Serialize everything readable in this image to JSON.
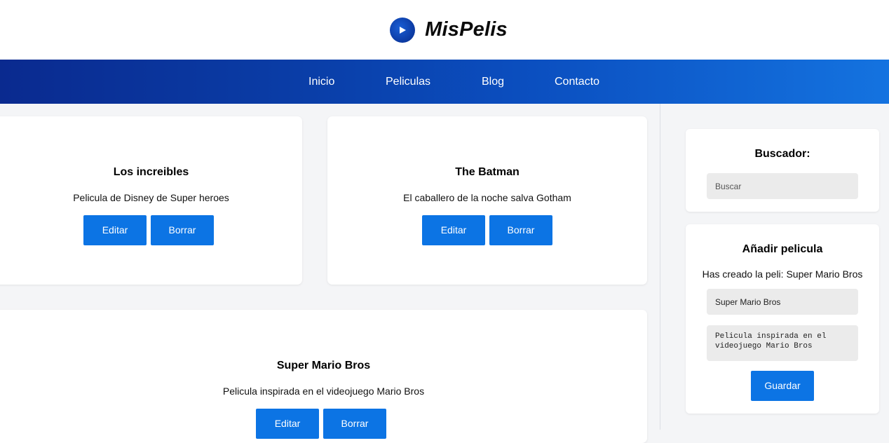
{
  "brand": {
    "name": "MisPelis",
    "accent": "#0c74e4"
  },
  "nav": {
    "items": [
      {
        "label": "Inicio"
      },
      {
        "label": "Peliculas"
      },
      {
        "label": "Blog"
      },
      {
        "label": "Contacto"
      }
    ]
  },
  "movies": [
    {
      "title": "Los increibles",
      "description": "Pelicula de Disney de Super heroes",
      "edit_label": "Editar",
      "delete_label": "Borrar"
    },
    {
      "title": "The Batman",
      "description": "El caballero de la noche salva Gotham",
      "edit_label": "Editar",
      "delete_label": "Borrar"
    },
    {
      "title": "Super Mario Bros",
      "description": "Pelicula inspirada en el videojuego Mario Bros",
      "edit_label": "Editar",
      "delete_label": "Borrar"
    }
  ],
  "search": {
    "title": "Buscador:",
    "placeholder": "Buscar",
    "value": ""
  },
  "add_movie": {
    "title": "Añadir pelicula",
    "message": "Has creado la peli: Super Mario Bros",
    "title_value": "Super Mario Bros",
    "description_value": "Pelicula inspirada en el videojuego Mario Bros",
    "submit_label": "Guardar"
  }
}
